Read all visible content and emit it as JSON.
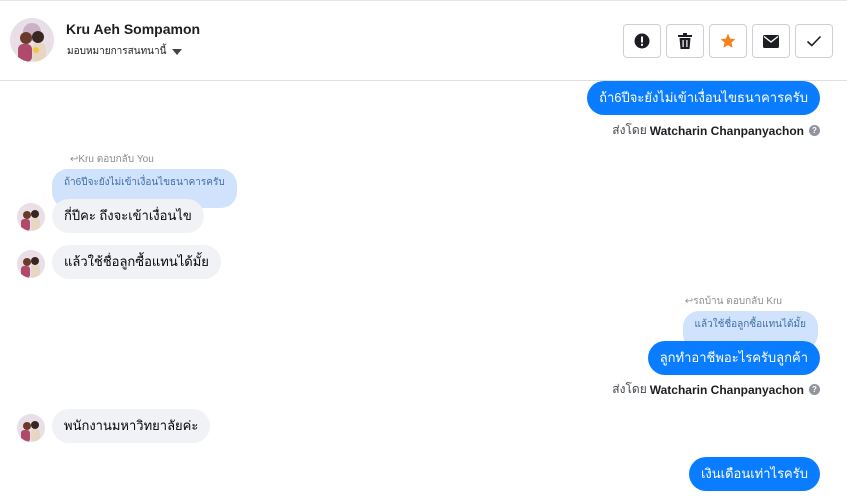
{
  "header": {
    "name": "Kru Aeh Sompamon",
    "assign_label": "มอบหมายการสนทนานี้"
  },
  "toolbar": {
    "icons": [
      "alert-icon",
      "trash-icon",
      "star-icon",
      "mail-icon",
      "check-icon"
    ],
    "star_color": "#f5821f"
  },
  "messages": {
    "m1": "ถ้า6ปีจะยังไม่เข้าเงื่อนไขธนาคารครับ",
    "sent1_prefix": "ส่งโดย",
    "sent1_name": "Watcharin Chanpanyachon",
    "reply1_label": "Kru ตอบกลับ You",
    "quote1": "ถ้า6ปีจะยังไม่เข้าเงื่อนไขธนาคารครับ",
    "m2": "กี่ปีคะ ถึงจะเข้าเงื่อนไข",
    "m3": "แล้วใช้ชื่อลูกซื้อแทนได้มั้ย",
    "reply2_label": "รถบ้าน ตอบกลับ Kru",
    "quote2": "แล้วใช้ชื่อลูกซื้อแทนได้มั้ย",
    "m4": "ลูกทำอาชีพอะไรครับลูกค้า",
    "sent2_prefix": "ส่งโดย",
    "sent2_name": "Watcharin Chanpanyachon",
    "m5": "พนักงานมหาวิทยาลัยค่ะ",
    "m6": "เงินเดือนเท่าไรครับ"
  },
  "colors": {
    "outgoing": "#0a7cff",
    "incoming": "#f0f2f5",
    "quote": "#d1e3fc"
  }
}
